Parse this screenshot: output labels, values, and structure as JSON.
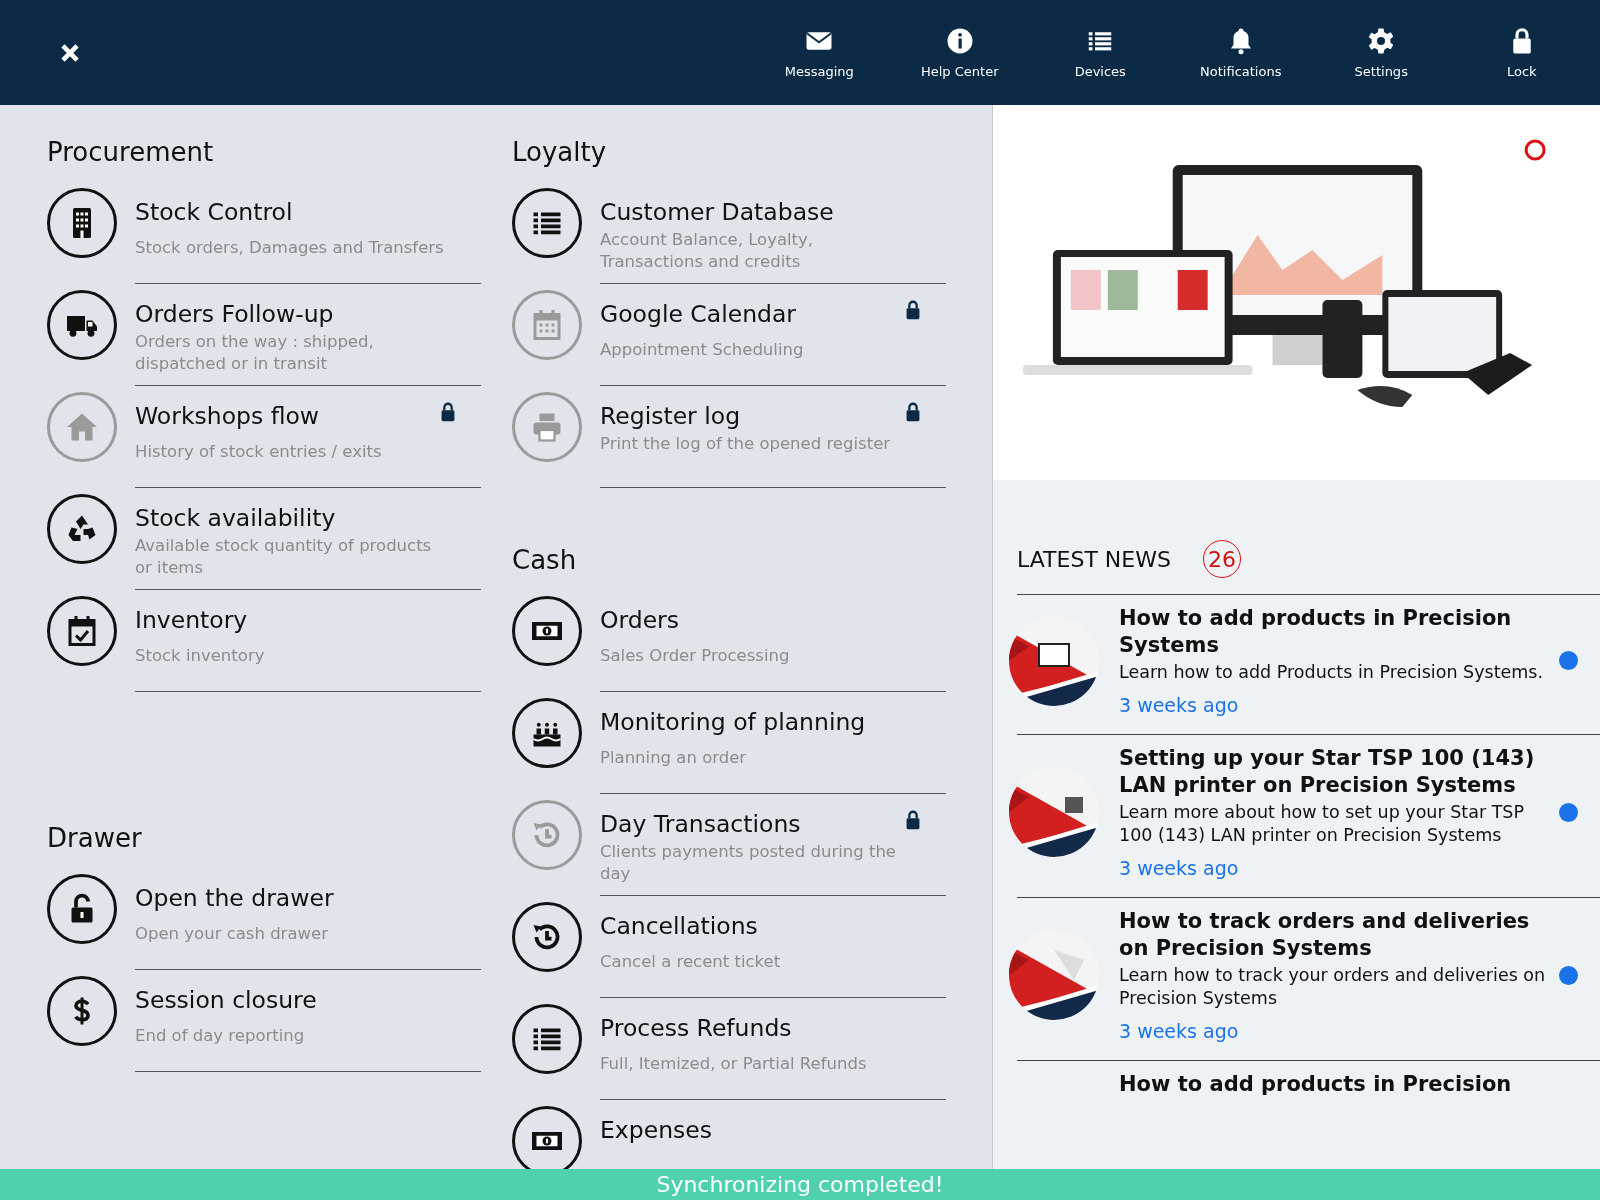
{
  "toolbar": {
    "items": [
      {
        "label": "Messaging"
      },
      {
        "label": "Help Center"
      },
      {
        "label": "Devices"
      },
      {
        "label": "Notifications"
      },
      {
        "label": "Settings"
      },
      {
        "label": "Lock"
      }
    ]
  },
  "columns": [
    {
      "sections": [
        {
          "title": "Procurement",
          "items": [
            {
              "title": "Stock Control",
              "subtitle": "Stock orders, Damages and Transfers",
              "locked": false
            },
            {
              "title": "Orders Follow-up",
              "subtitle": "Orders on the way : shipped, dispatched or in transit",
              "locked": false
            },
            {
              "title": "Workshops flow",
              "subtitle": "History of stock entries / exits",
              "locked": true
            },
            {
              "title": "Stock availability",
              "subtitle": "Available stock quantity of products or items",
              "locked": false
            },
            {
              "title": "Inventory",
              "subtitle": "Stock inventory",
              "locked": false
            }
          ]
        },
        {
          "title": "Drawer",
          "items": [
            {
              "title": "Open the drawer",
              "subtitle": "Open your cash drawer",
              "locked": false
            },
            {
              "title": "Session closure",
              "subtitle": "End of day reporting",
              "locked": false
            }
          ]
        }
      ]
    },
    {
      "sections": [
        {
          "title": "Loyalty",
          "items": [
            {
              "title": "Customer Database",
              "subtitle": "Account Balance, Loyalty, Transactions and credits",
              "locked": false
            },
            {
              "title": "Google Calendar",
              "subtitle": "Appointment Scheduling",
              "locked": true
            },
            {
              "title": "Register log",
              "subtitle": "Print the log of the opened register",
              "locked": true
            }
          ]
        },
        {
          "title": "Cash",
          "items": [
            {
              "title": "Orders",
              "subtitle": "Sales Order Processing",
              "locked": false
            },
            {
              "title": "Monitoring of planning",
              "subtitle": "Planning an order",
              "locked": false
            },
            {
              "title": "Day Transactions",
              "subtitle": "Clients payments posted during the day",
              "locked": true
            },
            {
              "title": "Cancellations",
              "subtitle": "Cancel a recent ticket",
              "locked": false
            },
            {
              "title": "Process Refunds",
              "subtitle": "Full, Itemized, or Partial Refunds",
              "locked": false
            },
            {
              "title": "Expenses",
              "locked": false
            }
          ]
        }
      ]
    }
  ],
  "news": {
    "title": "LATEST NEWS",
    "count": "26",
    "items": [
      {
        "title": "How to add products in Precision Systems",
        "description": "Learn how to add Products in Precision Systems.",
        "time": "3 weeks ago",
        "unread": true
      },
      {
        "title": "Setting up your Star TSP 100 (143) LAN  printer on Precision Systems",
        "description": "Learn more about how to set up your Star TSP 100 (143) LAN printer on Precision Systems",
        "time": "3 weeks ago",
        "unread": true
      },
      {
        "title": "How to track orders and deliveries on Precision Systems",
        "description": "Learn how to track your orders and deliveries on Precision Systems",
        "time": "3 weeks ago",
        "unread": true
      },
      {
        "title": "How to add products in Precision"
      }
    ]
  },
  "status_bar": {
    "message": "Synchronizing completed!"
  }
}
